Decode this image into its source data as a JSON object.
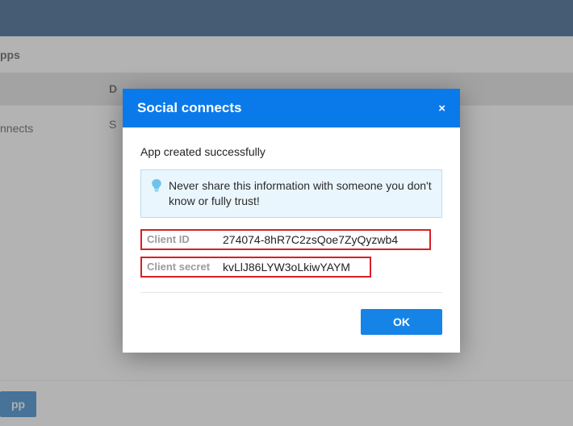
{
  "background": {
    "breadcrumb": "pps",
    "tab_fragment": "D",
    "side_item": "nnects",
    "main_fragment": "S",
    "footer_button": "pp"
  },
  "modal": {
    "title": "Social connects",
    "close_label": "×",
    "status": "App created successfully",
    "warning": "Never share this information with someone you don't know or fully trust!",
    "client_id": {
      "label": "Client ID",
      "value": "274074-8hR7C2zsQoe7ZyQyzwb4"
    },
    "client_secret": {
      "label": "Client secret",
      "value": "kvLlJ86LYW3oLkiwYAYM"
    },
    "ok_label": "OK"
  }
}
